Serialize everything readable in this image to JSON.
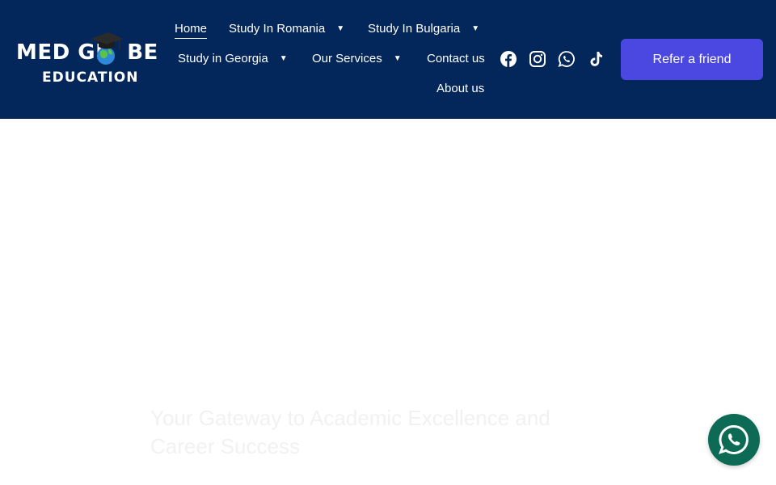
{
  "logo": {
    "line1": "MED GL",
    "line1_end": "BE",
    "line2": "EDUCATION"
  },
  "nav": {
    "home": "Home",
    "study_romania": "Study In Romania",
    "study_bulgaria": "Study In Bulgaria",
    "study_georgia": "Study in Georgia",
    "our_services": "Our Services",
    "contact_us": "Contact us",
    "about_us": "About us",
    "caret": "▼"
  },
  "social": {
    "icons": [
      "facebook-icon",
      "instagram-icon",
      "whatsapp-icon",
      "tiktok-icon"
    ]
  },
  "cta": {
    "refer_label": "Refer a friend"
  },
  "hero": {
    "title": "Your Gateway to Academic Excellence and Career Success"
  },
  "colors": {
    "header_bg": "#03275a",
    "button_bg": "#4a48e0",
    "whatsapp_float_bg": "#0d6b55",
    "hero_text": "#f1f1f1"
  }
}
